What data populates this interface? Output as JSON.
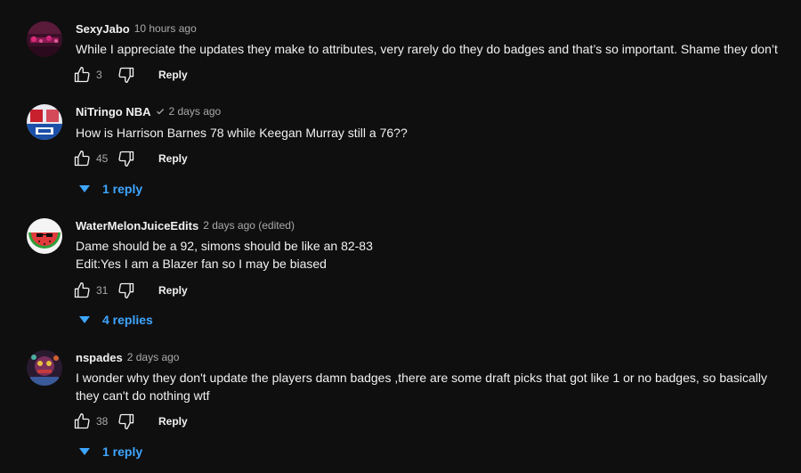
{
  "colors": {
    "background": "#0f0f0f",
    "text": "#f1f1f1",
    "secondary_text": "#aaaaaa",
    "link_blue": "#3ea6ff"
  },
  "reply_label": "Reply",
  "comments": [
    {
      "author": "SexyJabo",
      "verified": false,
      "time": "10 hours ago",
      "text_lines": [
        "While I appreciate the updates they make to attributes, very rarely do they do badges and that’s so important. Shame they don’t"
      ],
      "likes": "3",
      "replies_label": ""
    },
    {
      "author": "NiTringo NBA",
      "verified": true,
      "time": "2 days ago",
      "text_lines": [
        "How is Harrison Barnes 78 while Keegan Murray still a 76??"
      ],
      "likes": "45",
      "replies_label": "1 reply"
    },
    {
      "author": "WaterMelonJuiceEdits",
      "verified": false,
      "time": "2 days ago (edited)",
      "text_lines": [
        "Dame should be a 92, simons should be like an 82-83",
        "Edit:Yes I am a Blazer fan so I may be biased"
      ],
      "likes": "31",
      "replies_label": "4 replies"
    },
    {
      "author": "nspades",
      "verified": false,
      "time": "2 days ago",
      "text_lines": [
        "I wonder why they don't update the players damn badges ,there are some draft picks that got like 1 or no badges, so basically",
        "they can't do nothing wtf"
      ],
      "likes": "38",
      "replies_label": "1 reply"
    }
  ]
}
